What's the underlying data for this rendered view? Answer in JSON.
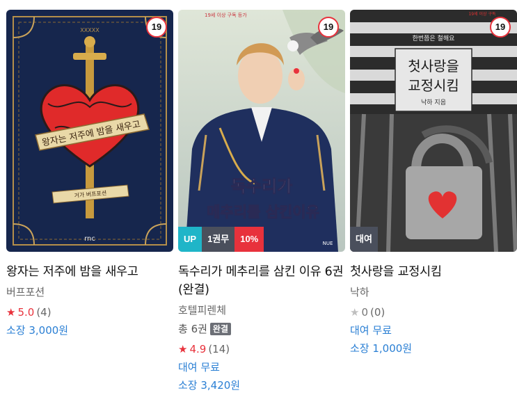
{
  "books": [
    {
      "age": "19",
      "title": "왕자는 저주에 밤을 새우고",
      "author": "버프포션",
      "rating": "5.0",
      "rating_count": "(4)",
      "own_price": "소장 3,000원",
      "cover_ribbon": "왕자는 저주에 밤을 새우고",
      "cover_ribbon2": "거가 버프포션",
      "cover_logo": "rnc",
      "cover_top": "XXXXX"
    },
    {
      "age": "19",
      "title": "독수리가 메추리를 삼킨 이유 6권 (완결)",
      "author": "호텔피렌체",
      "total_label": "총 6권",
      "completed_badge": "완결",
      "rating": "4.9",
      "rating_count": "(14)",
      "rent_label": "대여 무료",
      "own_price": "소장 3,420원",
      "tag_up": "UP",
      "tag_vol": "1권무",
      "tag_sale": "10%",
      "cover_title_1": "독수리가",
      "cover_title_2": "메추리를 삼킨이유",
      "cover_top_text": "19세 이상 구독 등가",
      "cover_logo": "NUE"
    },
    {
      "age": "19",
      "title": "첫사랑을 교정시킴",
      "author": "낙하",
      "rating": "0",
      "rating_count": "(0)",
      "rent_label": "대여 무료",
      "own_price": "소장 1,000원",
      "tag_rent": "대여",
      "cover_title_1": "첫사랑을",
      "cover_title_2": "교정시킴",
      "cover_author": "낙하 지음",
      "cover_top_text": "19세 이상 구독",
      "cover_subtitle": "한번쯤은 철해요"
    }
  ],
  "colors": {
    "accent_red": "#e8323c",
    "link_blue": "#2a7fd4",
    "tag_teal": "#1fb5c8",
    "tag_gray": "#4a4f5c"
  },
  "icons": {
    "star": "star-icon"
  }
}
